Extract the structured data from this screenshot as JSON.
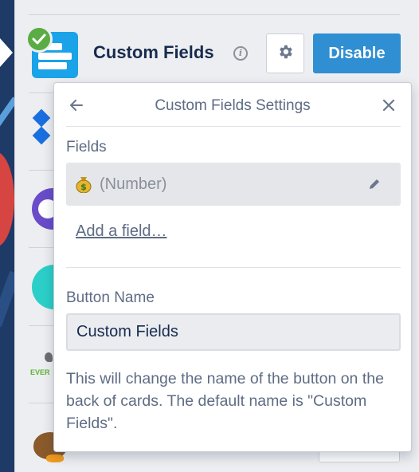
{
  "powerup": {
    "title": "Custom Fields",
    "disable_label": "Disable"
  },
  "popover": {
    "title": "Custom Fields Settings",
    "fields_label": "Fields",
    "fields": [
      {
        "icon": "money-bag-icon",
        "text": "(Number)"
      }
    ],
    "add_field_label": "Add a field…",
    "button_name_label": "Button Name",
    "button_name_value": "Custom Fields",
    "help_text": "This will change the name of the button on the back of cards. The default name is \"Custom Fields\"."
  },
  "colors": {
    "disable_button": "#2f8fd2",
    "custom_fields_icon": "#1aa3e8",
    "enabled_check": "#5aac44"
  }
}
